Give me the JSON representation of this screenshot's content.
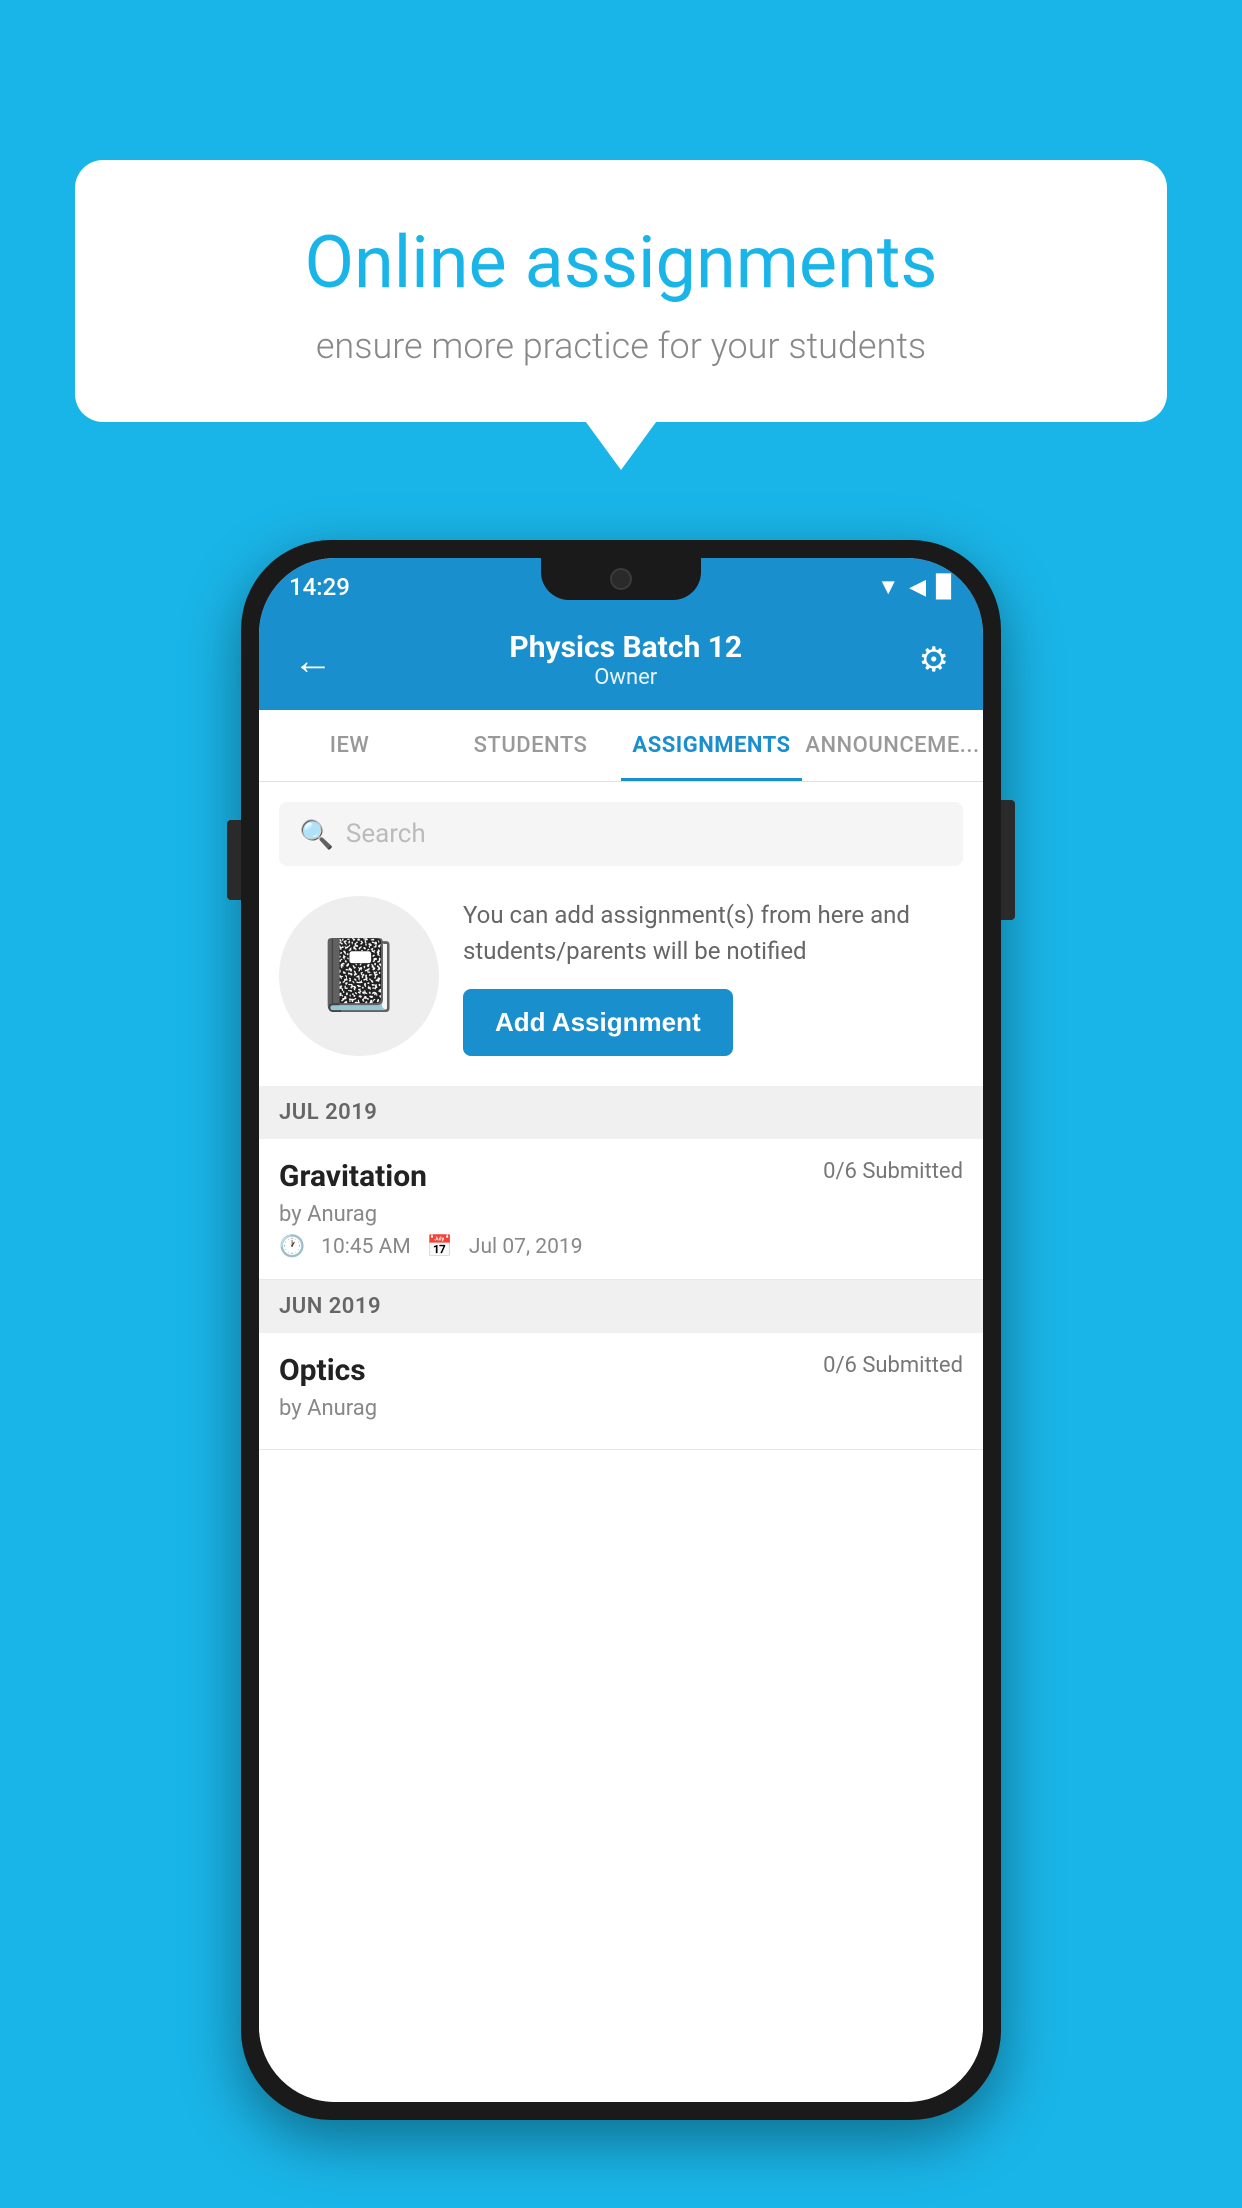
{
  "background": {
    "color": "#1ab5e8"
  },
  "speech_bubble": {
    "title": "Online assignments",
    "subtitle": "ensure more practice for your students"
  },
  "phone": {
    "status_bar": {
      "time": "14:29",
      "icons": "▲◀▉"
    },
    "app_bar": {
      "batch_name": "Physics Batch 12",
      "owner_label": "Owner",
      "back_label": "←",
      "settings_label": "⚙"
    },
    "tabs": [
      {
        "label": "IEW",
        "active": false
      },
      {
        "label": "STUDENTS",
        "active": false
      },
      {
        "label": "ASSIGNMENTS",
        "active": true
      },
      {
        "label": "ANNOUNCEMENTS",
        "active": false
      }
    ],
    "search": {
      "placeholder": "Search"
    },
    "empty_state": {
      "description": "You can add assignment(s) from here and students/parents will be notified",
      "add_button_label": "Add Assignment"
    },
    "sections": [
      {
        "label": "JUL 2019",
        "assignments": [
          {
            "name": "Gravitation",
            "submitted": "0/6 Submitted",
            "author": "by Anurag",
            "time": "10:45 AM",
            "date": "Jul 07, 2019"
          }
        ]
      },
      {
        "label": "JUN 2019",
        "assignments": [
          {
            "name": "Optics",
            "submitted": "0/6 Submitted",
            "author": "by Anurag",
            "time": "",
            "date": ""
          }
        ]
      }
    ]
  }
}
